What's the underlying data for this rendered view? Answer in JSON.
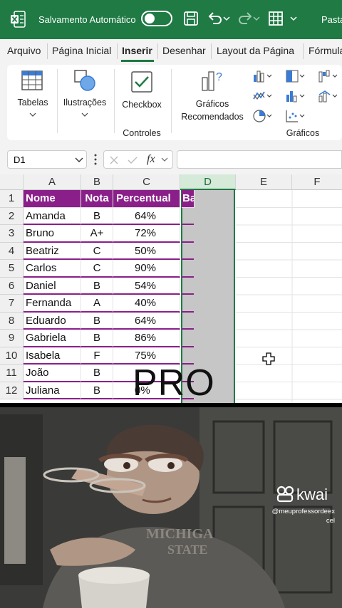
{
  "titlebar": {
    "autosave_label": "Salvamento Automático",
    "doc_name": "Pasta"
  },
  "tabs": [
    "Arquivo",
    "Página Inicial",
    "Inserir",
    "Desenhar",
    "Layout da Página",
    "Fórmula"
  ],
  "active_tab": "Inserir",
  "ribbon": {
    "tables": "Tabelas",
    "illustrations": "Ilustrações",
    "checkbox": "Checkbox",
    "controls_group": "Controles",
    "recommended_charts_1": "Gráficos",
    "recommended_charts_2": "Recomendados",
    "charts_group": "Gráficos"
  },
  "formula_bar": {
    "name_box": "D1",
    "fx": "fx",
    "formula": ""
  },
  "columns": [
    "A",
    "B",
    "C",
    "D",
    "E",
    "F"
  ],
  "rows": [
    "1",
    "2",
    "3",
    "4",
    "5",
    "6",
    "7",
    "8",
    "9",
    "10",
    "11",
    "12"
  ],
  "table": {
    "headers": [
      "Nome",
      "Nota",
      "Percentual",
      "Ba"
    ],
    "data": [
      [
        "Amanda",
        "B",
        "64%"
      ],
      [
        "Bruno",
        "A+",
        "72%"
      ],
      [
        "Beatriz",
        "C",
        "50%"
      ],
      [
        "Carlos",
        "C",
        "90%"
      ],
      [
        "Daniel",
        "B",
        "54%"
      ],
      [
        "Fernanda",
        "A",
        "40%"
      ],
      [
        "Eduardo",
        "B",
        "64%"
      ],
      [
        "Gabriela",
        "B",
        "86%"
      ],
      [
        "Isabela",
        "F",
        "75%"
      ],
      [
        "João",
        "B",
        ""
      ],
      [
        "Juliana",
        "B",
        "0%"
      ]
    ]
  },
  "overlay_text": "PRO",
  "watermark": {
    "brand": "kwai",
    "handle_line1": "@meuprofessordeex",
    "handle_line2": "cel"
  },
  "colors": {
    "excel_green": "#1f7a44",
    "header_purple": "#8a1f8a",
    "selection_gray": "#c6c6c6"
  }
}
